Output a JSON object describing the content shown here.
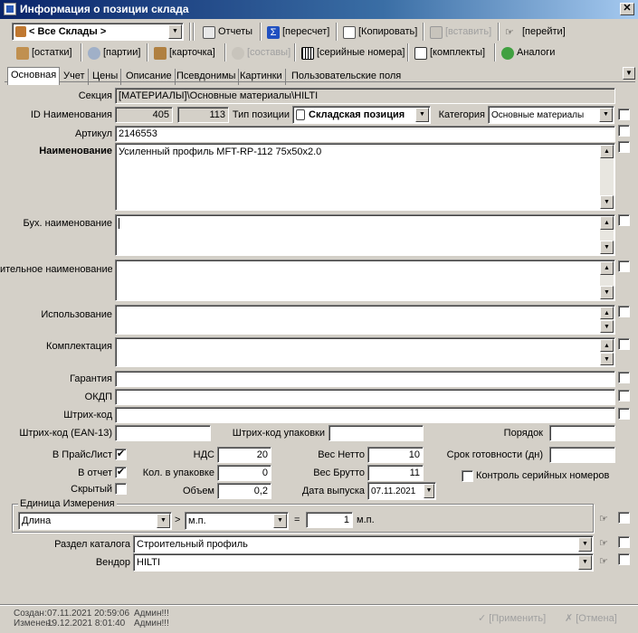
{
  "window": {
    "title": "Информация о позиции склада"
  },
  "toolbar1": {
    "warehouse": "< Все Склады >",
    "reports": "Отчеты",
    "recalc": "[пересчет]",
    "copy": "[Копировать]",
    "paste": "[вставить]",
    "goto": "[перейти]"
  },
  "toolbar2": {
    "stock": "[остатки]",
    "batches": "[партии]",
    "card": "[карточка]",
    "compositions": "[составы]",
    "serials": "[серийные номера]",
    "kits": "[комплекты]",
    "analogs": "Аналоги"
  },
  "tabs": [
    "Основная",
    "Учет",
    "Цены",
    "Описание",
    "Псевдонимы",
    "Картинки",
    "Пользовательские поля"
  ],
  "form": {
    "section_label": "Секция",
    "section_value": "[МАТЕРИАЛЫ]\\Основные материалы\\HILTI",
    "id_label": "ID Наименования",
    "id_value1": "405",
    "id_value2": "113",
    "type_label": "Тип позиции",
    "type_value": "Складская позиция",
    "category_label": "Категория",
    "category_value": "Основные материалы",
    "article_label": "Артикул",
    "article_value": "2146553",
    "name_label": "Наименование",
    "name_value": "Усиленный профиль MFT-RP-112 75х50х2.0",
    "acc_name_label": "Бух. наименование",
    "acc_name_value": "",
    "ext_name_label": "ительное наименование",
    "usage_label": "Использование",
    "kit_label": "Комплектация",
    "warranty_label": "Гарантия",
    "okdp_label": "ОКДП",
    "barcode_label": "Штрих-код",
    "ean13_label": "Штрих-код (EAN-13)",
    "pack_barcode_label": "Штрих-код упаковки",
    "order_label": "Порядок",
    "pricelist_label": "В ПрайсЛист",
    "report_label": "В отчет",
    "hidden_label": "Скрытый",
    "vat_label": "НДС",
    "vat_value": "20",
    "pack_qty_label": "Кол. в упаковке",
    "pack_qty_value": "0",
    "volume_label": "Объем",
    "volume_value": "0,2",
    "net_label": "Вес Нетто",
    "net_value": "10",
    "gross_label": "Вес Брутто",
    "gross_value": "11",
    "release_label": "Дата выпуска",
    "release_value": "07.11.2021",
    "ready_label": "Срок готовности (дн)",
    "serial_control_label": "Контроль серийных номеров"
  },
  "unit": {
    "group_title": "Единица Измерения",
    "kind": "Длина",
    "gt": ">",
    "unit": "м.п.",
    "eq": "=",
    "factor": "1",
    "unit2": "м.п."
  },
  "catalog": {
    "section_label": "Раздел каталога",
    "section_value": "Строительный профиль",
    "vendor_label": "Вендор",
    "vendor_value": "HILTI"
  },
  "status": {
    "created_label": "Создан:",
    "created_date": "07.11.2021 20:59:06",
    "created_user": "Админ!!!",
    "changed_label": "Изменен:",
    "changed_date": "19.12.2021 8:01:40",
    "changed_user": "Админ!!!"
  },
  "buttons": {
    "apply": "[Применить]",
    "cancel": "[Отмена]"
  }
}
